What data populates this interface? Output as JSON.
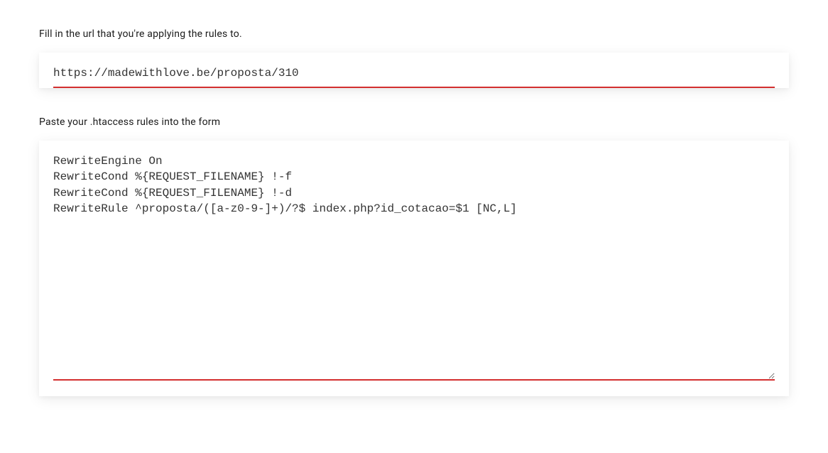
{
  "form": {
    "url_label": "Fill in the url that you're applying the rules to.",
    "url_value": "https://madewithlove.be/proposta/310",
    "htaccess_label": "Paste your .htaccess rules into the form",
    "htaccess_value": "RewriteEngine On\nRewriteCond %{REQUEST_FILENAME} !-f\nRewriteCond %{REQUEST_FILENAME} !-d\nRewriteRule ^proposta/([a-z0-9-]+)/?$ index.php?id_cotacao=$1 [NC,L]"
  }
}
